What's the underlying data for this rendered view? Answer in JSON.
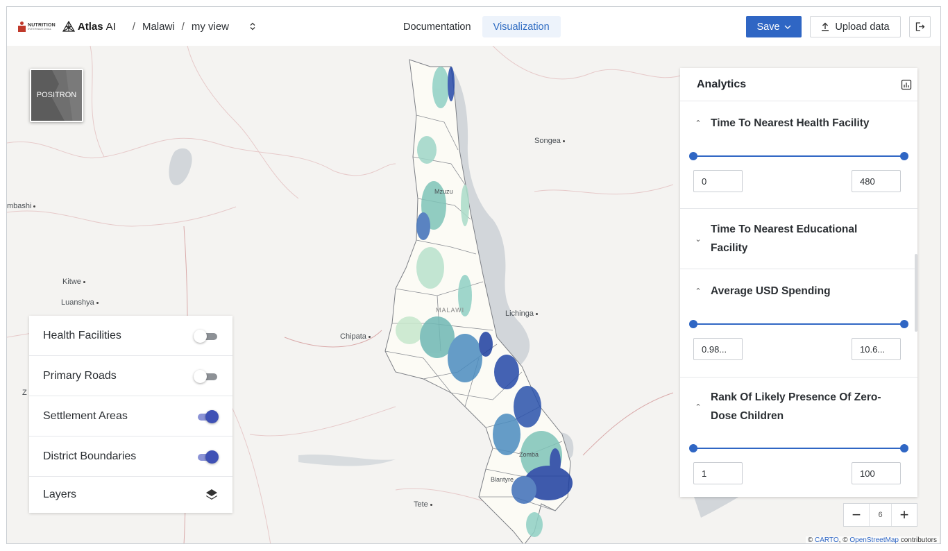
{
  "header": {
    "org_logo": {
      "line1": "NUTRITION",
      "line2": "INTERNATIONAL"
    },
    "brand_name": "Atlas",
    "brand_suffix": "AI",
    "breadcrumb": [
      "Malawi",
      "my view"
    ],
    "separator": "/",
    "tabs": [
      {
        "label": "Documentation",
        "active": false
      },
      {
        "label": "Visualization",
        "active": true
      }
    ],
    "save_label": "Save",
    "upload_label": "Upload data",
    "icons": {
      "switcher": "updown-chevron-icon",
      "save_menu": "chevron-down-icon",
      "upload": "upload-icon",
      "logout": "logout-icon"
    }
  },
  "map": {
    "basemap_label": "POSITRON",
    "places": [
      {
        "name": "Songea",
        "dot": true
      },
      {
        "name": "mbashi",
        "dot": true
      },
      {
        "name": "Kitwe",
        "dot": true
      },
      {
        "name": "Luanshya",
        "dot": true
      },
      {
        "name": "Chipata",
        "dot": true
      },
      {
        "name": "Lichinga",
        "dot": true
      },
      {
        "name": "Tete",
        "dot": true
      },
      {
        "name": "Mzuzu",
        "dot": true
      },
      {
        "name": "MALAWI",
        "dot": false
      },
      {
        "name": "Zomba",
        "dot": false
      },
      {
        "name": "Blantyre",
        "dot": false
      },
      {
        "name": "Z",
        "dot": false
      }
    ],
    "attribution": {
      "prefix": "©",
      "carto": "CARTO",
      "sep": ", ©",
      "osm": "OpenStreetMap",
      "suffix": "contributors"
    },
    "zoom_level": "6",
    "zoom_out": "−",
    "zoom_in": "+",
    "colors": {
      "water": "#d2d6da",
      "land": "#f4f3f1",
      "low_density": "#7fc4b8",
      "high_density": "#1d3fa0"
    }
  },
  "layers_panel": {
    "items": [
      {
        "label": "Health Facilities",
        "enabled": false
      },
      {
        "label": "Primary Roads",
        "enabled": false
      },
      {
        "label": "Settlement Areas",
        "enabled": true
      },
      {
        "label": "District Boundaries",
        "enabled": true
      }
    ],
    "footer_label": "Layers",
    "footer_icon": "layers-icon"
  },
  "analytics": {
    "title": "Analytics",
    "title_icon": "chart-widget-icon",
    "sections": [
      {
        "title_line1": "Time To Nearest Health Facility",
        "title_line2": "",
        "expanded": true,
        "min": "0",
        "max": "480"
      },
      {
        "title_line1": "Time To Nearest Educational",
        "title_line2": "Facility",
        "expanded": false
      },
      {
        "title_line1": "Average USD Spending",
        "title_line2": "",
        "expanded": true,
        "min": "0.98...",
        "max": "10.6..."
      },
      {
        "title_line1": "Rank Of Likely Presence Of Zero-",
        "title_line2": "Dose Children",
        "expanded": true,
        "min": "1",
        "max": "100"
      }
    ]
  }
}
